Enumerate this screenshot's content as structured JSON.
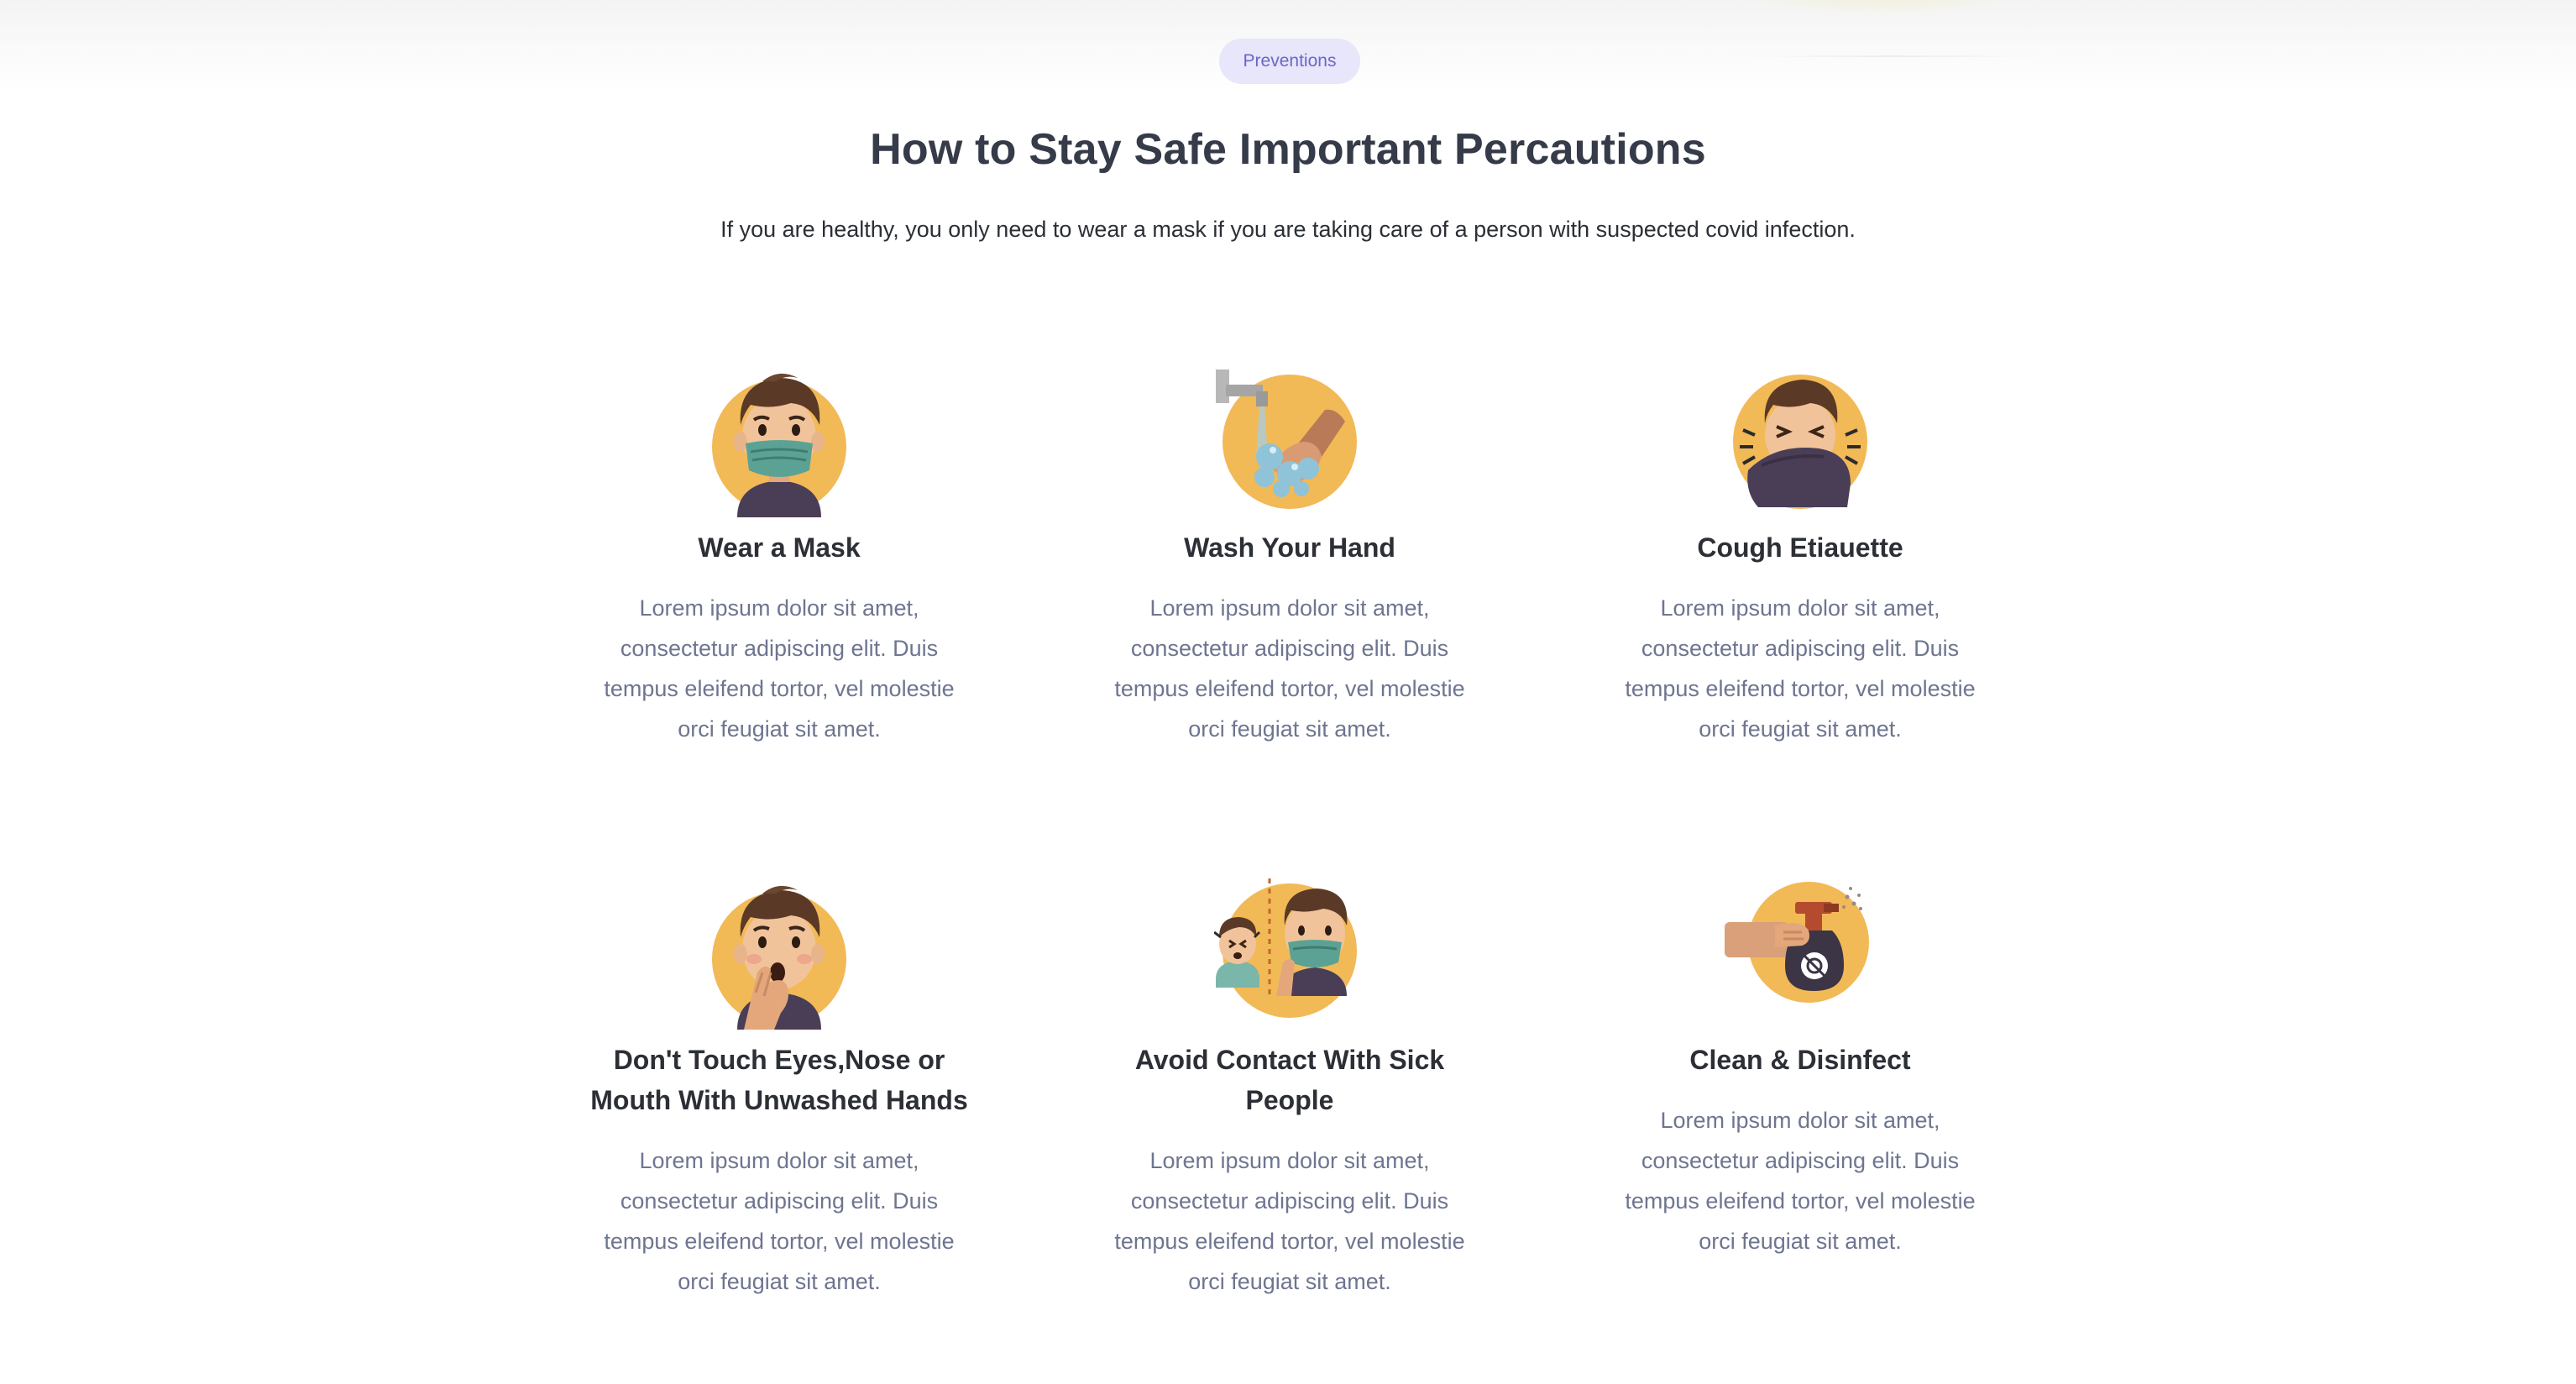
{
  "section": {
    "badge": "Preventions",
    "title": "How to Stay Safe Important Percautions",
    "subtitle": "If you are healthy, you only need to wear a mask if you are taking care of a person with suspected covid infection."
  },
  "colors": {
    "accent": "#6b66c7",
    "badge_bg": "#e7e6fa",
    "icon_circle": "#f2b957",
    "title": "#353b48",
    "body_text": "#6e7590"
  },
  "cards": [
    {
      "icon": "mask-person-icon",
      "title": "Wear a Mask",
      "text": "Lorem ipsum dolor sit amet, consectetur adipiscing elit. Duis tempus eleifend tortor, vel molestie orci feugiat sit amet."
    },
    {
      "icon": "hand-washing-icon",
      "title": "Wash Your Hand",
      "text": "Lorem ipsum dolor sit amet, consectetur adipiscing elit. Duis tempus eleifend tortor, vel molestie orci feugiat sit amet."
    },
    {
      "icon": "cough-elbow-icon",
      "title": "Cough Etiauette",
      "text": "Lorem ipsum dolor sit amet, consectetur adipiscing elit. Duis tempus eleifend tortor, vel molestie orci feugiat sit amet."
    },
    {
      "icon": "no-face-touch-icon",
      "title": "Don't Touch Eyes,Nose or Mouth With Unwashed Hands",
      "text": "Lorem ipsum dolor sit amet, consectetur adipiscing elit. Duis tempus eleifend tortor, vel molestie orci feugiat sit amet."
    },
    {
      "icon": "social-distance-icon",
      "title": "Avoid Contact With Sick People",
      "text": "Lorem ipsum dolor sit amet, consectetur adipiscing elit. Duis tempus eleifend tortor, vel molestie orci feugiat sit amet."
    },
    {
      "icon": "disinfect-spray-icon",
      "title": "Clean & Disinfect",
      "text": "Lorem ipsum dolor sit amet, consectetur adipiscing elit. Duis tempus eleifend tortor, vel molestie orci feugiat sit amet."
    }
  ]
}
